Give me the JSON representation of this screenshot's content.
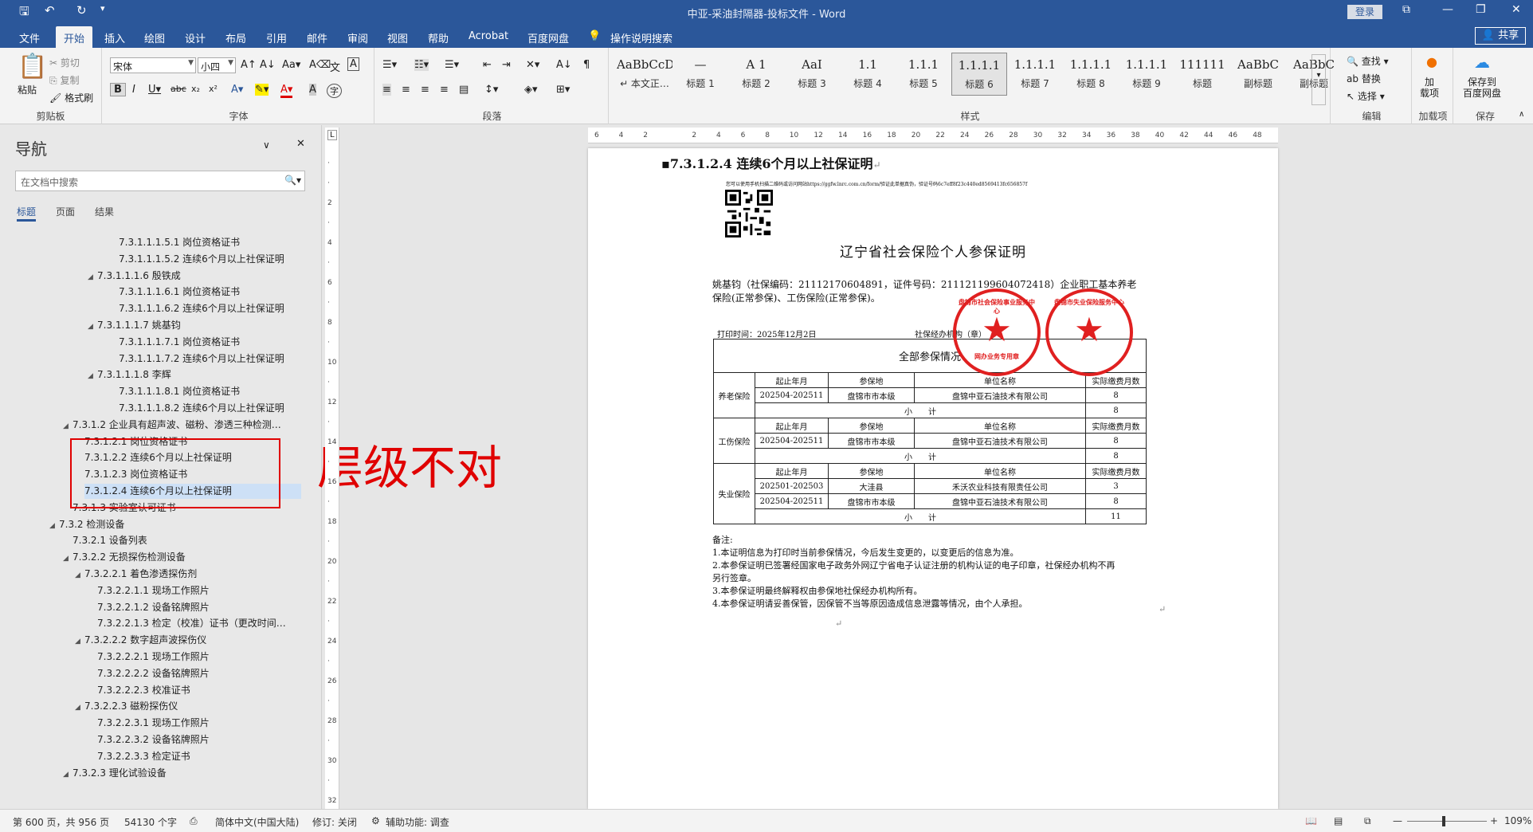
{
  "titlebar": {
    "title": "中亚-采油封隔器-投标文件 - Word",
    "login": "登录",
    "min": "—",
    "restore": "❐",
    "close": "✕",
    "display": "⧉"
  },
  "tabs": [
    "文件",
    "开始",
    "插入",
    "绘图",
    "设计",
    "布局",
    "引用",
    "邮件",
    "审阅",
    "视图",
    "帮助",
    "Acrobat",
    "百度网盘"
  ],
  "tellme": "操作说明搜索",
  "share": "共享",
  "ribbon": {
    "clipboard": {
      "label": "剪贴板",
      "paste": "粘贴",
      "cut": "剪切",
      "copy": "复制",
      "format_painter": "格式刷"
    },
    "font": {
      "label": "字体",
      "name": "宋体",
      "size": "小四"
    },
    "paragraph": {
      "label": "段落"
    },
    "styles": {
      "label": "样式",
      "items": [
        {
          "pv": "AaBbCcDdI",
          "nm": "↵ 本文正…"
        },
        {
          "pv": "—",
          "nm": "标题 1"
        },
        {
          "pv": "A 1",
          "nm": "标题 2"
        },
        {
          "pv": "AaI",
          "nm": "标题 3"
        },
        {
          "pv": "1.1",
          "nm": "标题 4"
        },
        {
          "pv": "1.1.1",
          "nm": "标题 5"
        },
        {
          "pv": "1.1.1.1",
          "nm": "标题 6"
        },
        {
          "pv": "1.1.1.1",
          "nm": "标题 7"
        },
        {
          "pv": "1.1.1.1",
          "nm": "标题 8"
        },
        {
          "pv": "1.1.1.1",
          "nm": "标题 9"
        },
        {
          "pv": "111111",
          "nm": "标题"
        },
        {
          "pv": "AaBbC",
          "nm": "副标题"
        },
        {
          "pv": "AaBbC",
          "nm": "副标题"
        }
      ]
    },
    "editing": {
      "label": "编辑",
      "find": "查找",
      "replace": "替换",
      "select": "选择"
    },
    "addins": {
      "label": "加载项",
      "btn": "加\n载项"
    },
    "save": {
      "label": "保存",
      "btn": "保存到\n百度网盘"
    }
  },
  "nav": {
    "title": "导航",
    "search_placeholder": "在文档中搜索",
    "tabs": [
      "标题",
      "页面",
      "结果"
    ],
    "items": [
      {
        "t": "7.3.1.1.1.5.1 岗位资格证书",
        "lv": 4,
        "tri": false
      },
      {
        "t": "7.3.1.1.1.5.2 连续6个月以上社保证明",
        "lv": 4,
        "tri": false
      },
      {
        "t": "7.3.1.1.1.6 殷铁成",
        "lv": 3,
        "tri": true
      },
      {
        "t": "7.3.1.1.1.6.1 岗位资格证书",
        "lv": 4,
        "tri": false
      },
      {
        "t": "7.3.1.1.1.6.2 连续6个月以上社保证明",
        "lv": 4,
        "tri": false
      },
      {
        "t": "7.3.1.1.1.7 姚基钧",
        "lv": 3,
        "tri": true
      },
      {
        "t": "7.3.1.1.1.7.1 岗位资格证书",
        "lv": 4,
        "tri": false
      },
      {
        "t": "7.3.1.1.1.7.2 连续6个月以上社保证明",
        "lv": 4,
        "tri": false
      },
      {
        "t": "7.3.1.1.1.8 李辉",
        "lv": 3,
        "tri": true
      },
      {
        "t": "7.3.1.1.1.8.1 岗位资格证书",
        "lv": 4,
        "tri": false
      },
      {
        "t": "7.3.1.1.1.8.2 连续6个月以上社保证明",
        "lv": 4,
        "tri": false
      },
      {
        "t": "7.3.1.2 企业具有超声波、磁粉、渗透三种检测…",
        "lv": 1,
        "tri": true
      },
      {
        "t": "7.3.1.2.1 岗位资格证书",
        "lv": 2,
        "tri": false
      },
      {
        "t": "7.3.1.2.2 连续6个月以上社保证明",
        "lv": 2,
        "tri": false
      },
      {
        "t": "7.3.1.2.3 岗位资格证书",
        "lv": 2,
        "tri": false
      },
      {
        "t": "7.3.1.2.4 连续6个月以上社保证明",
        "lv": 2,
        "tri": false,
        "hl": true
      },
      {
        "t": "7.3.1.3 实验室认可证书",
        "lv": 1,
        "tri": false
      },
      {
        "t": "7.3.2 检测设备",
        "lv": 0,
        "tri": true
      },
      {
        "t": "7.3.2.1 设备列表",
        "lv": 1,
        "tri": false
      },
      {
        "t": "7.3.2.2 无损探伤检测设备",
        "lv": 1,
        "tri": true
      },
      {
        "t": "7.3.2.2.1 着色渗透探伤剂",
        "lv": 2,
        "tri": true
      },
      {
        "t": "7.3.2.2.1.1 现场工作照片",
        "lv": 3,
        "tri": false
      },
      {
        "t": "7.3.2.2.1.2 设备铭牌照片",
        "lv": 3,
        "tri": false
      },
      {
        "t": "7.3.2.2.1.3 检定（校准）证书（更改时间…",
        "lv": 3,
        "tri": false
      },
      {
        "t": "7.3.2.2.2 数字超声波探伤仪",
        "lv": 2,
        "tri": true
      },
      {
        "t": "7.3.2.2.2.1 现场工作照片",
        "lv": 3,
        "tri": false
      },
      {
        "t": "7.3.2.2.2.2 设备铭牌照片",
        "lv": 3,
        "tri": false
      },
      {
        "t": "7.3.2.2.2.3 校准证书",
        "lv": 3,
        "tri": false
      },
      {
        "t": "7.3.2.2.3 磁粉探伤仪",
        "lv": 2,
        "tri": true
      },
      {
        "t": "7.3.2.2.3.1 现场工作照片",
        "lv": 3,
        "tri": false
      },
      {
        "t": "7.3.2.2.3.2 设备铭牌照片",
        "lv": 3,
        "tri": false
      },
      {
        "t": "7.3.2.2.3.3 检定证书",
        "lv": 3,
        "tri": false
      },
      {
        "t": "7.3.2.3 理化试验设备",
        "lv": 1,
        "tri": true
      }
    ]
  },
  "annotation": "层级不对",
  "document": {
    "heading": "7.3.1.2.4 连续6个月以上社保证明",
    "verify": "您可以使用手机扫描二维码或访问网站https://ggfw.lnrc.com.cn/form/验证此单据真伪，验证号码6c7eff8f23c440ed8569413fc656857f",
    "title": "辽宁省社会保险个人参保证明",
    "person_line1": "姚基钧（社保编码：21112170604891，证件号码：211121199604072418）企业职工基本养老",
    "person_line2": "保险(正常参保)、工伤保险(正常参保)。",
    "print_time": "打印时间：2025年12月2日",
    "agency": "社保经办机构（章）",
    "table_title": "全部参保情况",
    "col_start": "起止年月",
    "col_place": "参保地",
    "col_unit": "单位名称",
    "col_months": "实际缴费月数",
    "subtotal": "小　　计",
    "pension": {
      "name": "养老保险",
      "rows": [
        [
          "202504-202511",
          "盘锦市市本级",
          "盘锦中亚石油技术有限公司",
          "8"
        ]
      ],
      "total": "8"
    },
    "injury": {
      "name": "工伤保险",
      "rows": [
        [
          "202504-202511",
          "盘锦市市本级",
          "盘锦中亚石油技术有限公司",
          "8"
        ]
      ],
      "total": "8"
    },
    "unemp": {
      "name": "失业保险",
      "rows": [
        [
          "202501-202503",
          "大洼县",
          "禾沃农业科技有限责任公司",
          "3"
        ],
        [
          "202504-202511",
          "盘锦市市本级",
          "盘锦中亚石油技术有限公司",
          "8"
        ]
      ],
      "total": "11"
    },
    "notes_title": "备注:",
    "notes": [
      "1.本证明信息为打印时当前参保情况，今后发生变更的，以变更后的信息为准。",
      "2.本参保证明已签署经国家电子政务外网辽宁省电子认证注册的机构认证的电子印章，社保经办机构不再",
      "另行签章。",
      "3.本参保证明最终解释权由参保地社保经办机构所有。",
      "4.本参保证明请妥善保管，因保管不当等原因造成信息泄露等情况，由个人承担。"
    ],
    "seal1_text": "盘锦市社会保险事业服务中心",
    "seal1_sub": "网办业务专用章",
    "seal2_text": "盘锦市失业保险服务中心"
  },
  "status": {
    "page": "第 600 页，共 956 页",
    "words": "54130 个字",
    "lang": "简体中文(中国大陆)",
    "track": "修订: 关闭",
    "access": "辅助功能: 调查",
    "zoom": "109%"
  },
  "colors": {
    "accent": "#2b579a",
    "red": "#e00000"
  }
}
